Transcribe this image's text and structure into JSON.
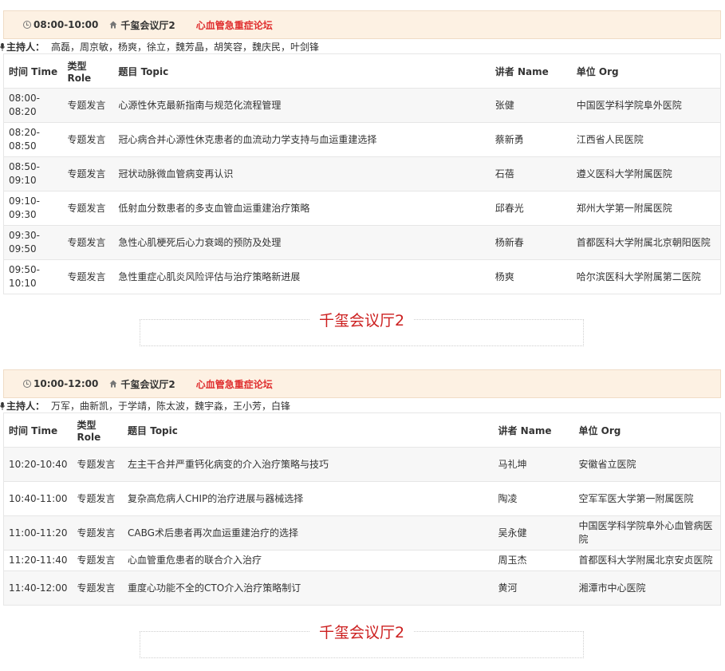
{
  "sessions": [
    {
      "time": "08:00-10:00",
      "hall": "千玺会议厅2",
      "forum": "心血管急重症论坛",
      "hosts_label": "主持人：",
      "hosts": "高磊，周京敏，杨爽，徐立，魏芳晶，胡笑容，魏庆民，叶剑锋",
      "headers": {
        "time": "时间 Time",
        "role": "类型 Role",
        "topic": "题目 Topic",
        "speaker": "讲者 Name",
        "org": "单位 Org"
      },
      "rows": [
        {
          "time": "08:00-08:20",
          "role": "专题发言",
          "topic": "心源性休克最新指南与规范化流程管理",
          "speaker": "张健",
          "org": "中国医学科学院阜外医院"
        },
        {
          "time": "08:20-08:50",
          "role": "专题发言",
          "topic": "冠心病合并心源性休克患者的血流动力学支持与血运重建选择",
          "speaker": "蔡新勇",
          "org": "江西省人民医院"
        },
        {
          "time": "08:50-09:10",
          "role": "专题发言",
          "topic": "冠状动脉微血管病变再认识",
          "speaker": "石蓓",
          "org": "遵义医科大学附属医院"
        },
        {
          "time": "09:10-09:30",
          "role": "专题发言",
          "topic": "低射血分数患者的多支血管血运重建治疗策略",
          "speaker": "邱春光",
          "org": "郑州大学第一附属医院"
        },
        {
          "time": "09:30-09:50",
          "role": "专题发言",
          "topic": "急性心肌梗死后心力衰竭的预防及处理",
          "speaker": "杨新春",
          "org": "首都医科大学附属北京朝阳医院"
        },
        {
          "time": "09:50-10:10",
          "role": "专题发言",
          "topic": "急性重症心肌炎风险评估与治疗策略新进展",
          "speaker": "杨爽",
          "org": "哈尔滨医科大学附属第二医院"
        }
      ]
    },
    {
      "time": "10:00-12:00",
      "hall": "千玺会议厅2",
      "forum": "心血管急重症论坛",
      "hosts_label": "主持人：",
      "hosts": "万军，曲新凯，于学靖，陈太波，魏宇淼，王小芳，白锋",
      "headers": {
        "time": "时间 Time",
        "role": "类型 Role",
        "topic": "题目 Topic",
        "speaker": "讲者 Name",
        "org": "单位 Org"
      },
      "rows": [
        {
          "time": "10:20-10:40",
          "role": "专题发言",
          "topic": "左主干合并严重钙化病变的介入治疗策略与技巧",
          "speaker": "马礼坤",
          "org": "安徽省立医院"
        },
        {
          "time": "10:40-11:00",
          "role": "专题发言",
          "topic": "复杂高危病人CHIP的治疗进展与器械选择",
          "speaker": "陶凌",
          "org": "空军军医大学第一附属医院"
        },
        {
          "time": "11:00-11:20",
          "role": "专题发言",
          "topic": "CABG术后患者再次血运重建治疗的选择",
          "speaker": "吴永健",
          "org": "中国医学科学院阜外心血管病医院"
        },
        {
          "time": "11:20-11:40",
          "role": "专题发言",
          "topic": "心血管重危患者的联合介入治疗",
          "speaker": "周玉杰",
          "org": "首都医科大学附属北京安贞医院"
        },
        {
          "time": "11:40-12:00",
          "role": "专题发言",
          "topic": "重度心功能不全的CTO介入治疗策略制订",
          "speaker": "黄河",
          "org": "湘潭市中心医院"
        }
      ]
    }
  ],
  "hall_boxes": [
    "千玺会议厅2",
    "千玺会议厅2"
  ],
  "colors": {
    "header_bg": "#fdf1e3",
    "forum": "#e03030",
    "hall_title": "#cc1f1f"
  },
  "icons": {
    "time": "clock-icon",
    "hall": "home-icon",
    "hosts": "microphone-icon"
  }
}
